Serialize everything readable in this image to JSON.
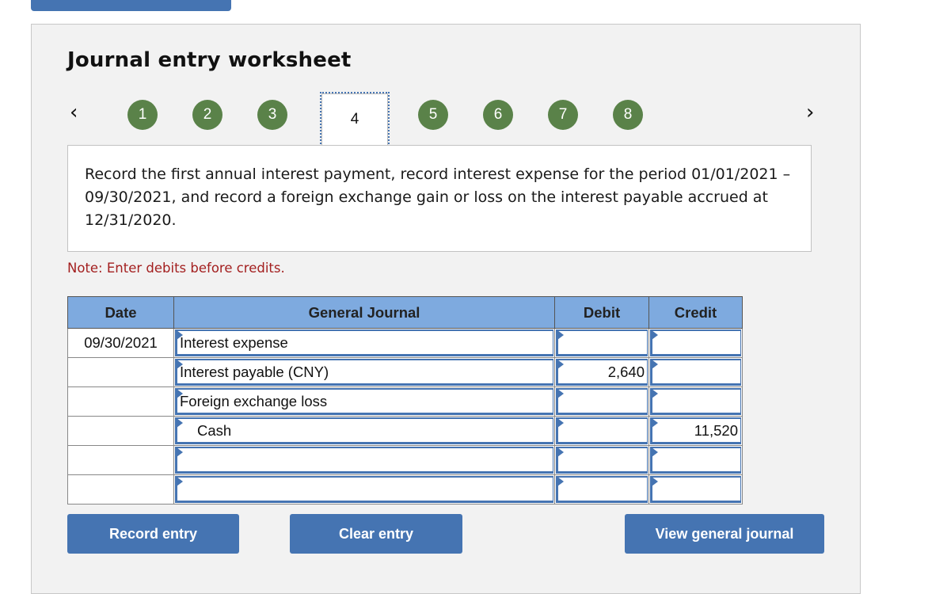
{
  "header": {
    "title": "Journal entry worksheet"
  },
  "steps": {
    "prev_icon": "chevron-left-icon",
    "next_icon": "chevron-right-icon",
    "items": [
      {
        "label": "1",
        "state": "completed"
      },
      {
        "label": "2",
        "state": "completed"
      },
      {
        "label": "3",
        "state": "completed"
      },
      {
        "label": "4",
        "state": "current"
      },
      {
        "label": "5",
        "state": "completed"
      },
      {
        "label": "6",
        "state": "completed"
      },
      {
        "label": "7",
        "state": "completed"
      },
      {
        "label": "8",
        "state": "completed"
      }
    ],
    "colors": {
      "completed": "#5a8249",
      "current_outline": "#4574b2"
    }
  },
  "prompt": {
    "text": "Record the first annual interest payment, record interest expense for the period 01/01/2021 – 09/30/2021, and record a foreign exchange gain or loss on the interest payable accrued at 12/31/2020."
  },
  "note": "Note: Enter debits before credits.",
  "journal": {
    "headers": {
      "date": "Date",
      "account": "General Journal",
      "debit": "Debit",
      "credit": "Credit"
    },
    "rows": [
      {
        "date": "09/30/2021",
        "account": "Interest expense",
        "debit": "",
        "credit": "",
        "indent": false
      },
      {
        "date": "",
        "account": "Interest payable (CNY)",
        "debit": "2,640",
        "credit": "",
        "indent": false
      },
      {
        "date": "",
        "account": "Foreign exchange loss",
        "debit": "",
        "credit": "",
        "indent": false
      },
      {
        "date": "",
        "account": "Cash",
        "debit": "",
        "credit": "11,520",
        "indent": true
      },
      {
        "date": "",
        "account": "",
        "debit": "",
        "credit": "",
        "indent": false
      },
      {
        "date": "",
        "account": "",
        "debit": "",
        "credit": "",
        "indent": false
      }
    ]
  },
  "buttons": {
    "record": "Record entry",
    "clear": "Clear entry",
    "view": "View general journal"
  },
  "colors": {
    "accent": "#4574b2",
    "header_bg": "#7eaadf",
    "note": "#a31f1f"
  }
}
